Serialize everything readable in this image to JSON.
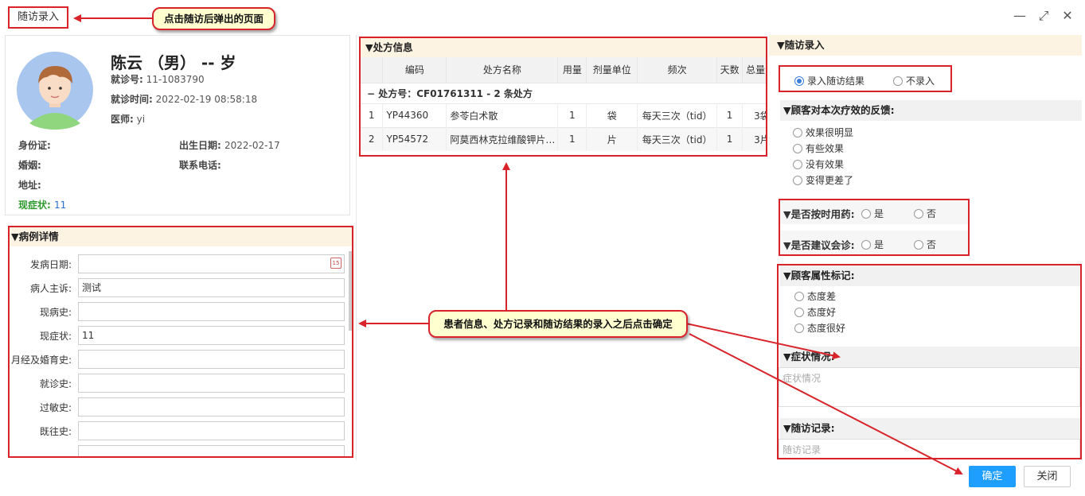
{
  "window": {
    "title": "随访录入"
  },
  "annotations": {
    "popup_note": "点击随访后弹出的页面",
    "confirm_note": "患者信息、处方记录和随访结果的录入之后点击确定"
  },
  "patient": {
    "name_line": "陈云 （男） -- 岁",
    "visit_no_label": "就诊号:",
    "visit_no": "11-1083790",
    "visit_time_label": "就诊时间:",
    "visit_time": "2022-02-19 08:58:18",
    "doctor_label": "医师:",
    "doctor": "yi",
    "id_label": "身份证:",
    "id_value": "",
    "birth_label": "出生日期:",
    "birth": "2022-02-17",
    "marriage_label": "婚姻:",
    "marriage": "",
    "phone_label": "联系电话:",
    "phone": "",
    "address_label": "地址:",
    "address": "",
    "symptom_label": "现症状:",
    "symptom": "11"
  },
  "case_detail": {
    "title": "▼病例详情",
    "fields": [
      {
        "label": "发病日期:",
        "value": ""
      },
      {
        "label": "病人主诉:",
        "value": "测试"
      },
      {
        "label": "现病史:",
        "value": ""
      },
      {
        "label": "现症状:",
        "value": "11"
      },
      {
        "label": "月经及婚育史:",
        "value": ""
      },
      {
        "label": "就诊史:",
        "value": ""
      },
      {
        "label": "过敏史:",
        "value": ""
      },
      {
        "label": "既往史:",
        "value": ""
      }
    ]
  },
  "prescription": {
    "title": "▼处方信息",
    "columns": [
      "",
      "编码",
      "处方名称",
      "用量",
      "剂量单位",
      "频次",
      "天数",
      "总量"
    ],
    "group_label": "−   处方号：CF01761311 - 2 条处方",
    "rows": [
      [
        "1",
        "YP44360",
        "参苓白术散",
        "1",
        "袋",
        "每天三次（tid）",
        "1",
        "3袋"
      ],
      [
        "2",
        "YP54572",
        "阿莫西林克拉维酸钾片…",
        "1",
        "片",
        "每天三次（tid）",
        "1",
        "3片"
      ]
    ]
  },
  "followup": {
    "title": "▼随访录入",
    "record_options": [
      "录入随访结果",
      "不录入"
    ],
    "feedback_title": "▼顾客对本次疗效的反馈:",
    "feedback_options": [
      "效果很明显",
      "有些效果",
      "没有效果",
      "变得更差了"
    ],
    "on_time_label": "▼是否按时用药:",
    "consult_label": "▼是否建议会诊:",
    "yes": "是",
    "no": "否",
    "attr_title": "▼顾客属性标记:",
    "attr_options": [
      "态度差",
      "态度好",
      "态度很好"
    ],
    "symptom_title": "▼症状情况:",
    "symptom_placeholder": "症状情况",
    "record_title": "▼随访记录:",
    "record_placeholder": "随访记录"
  },
  "buttons": {
    "ok": "确定",
    "close": "关闭"
  },
  "colors": {
    "highlight": "#d9232a",
    "primary": "#1e9fff",
    "section_bg": "#fdf3e3"
  }
}
